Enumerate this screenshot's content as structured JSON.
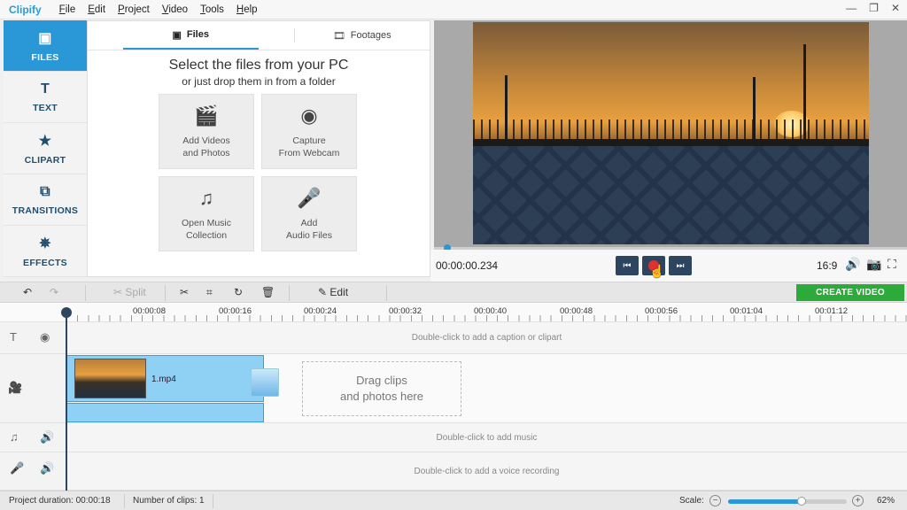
{
  "app": {
    "logo": "Clipify",
    "menu": [
      {
        "key": "F",
        "rest": "ile"
      },
      {
        "key": "E",
        "rest": "dit"
      },
      {
        "key": "P",
        "rest": "roject"
      },
      {
        "key": "V",
        "rest": "ideo"
      },
      {
        "key": "T",
        "rest": "ools"
      },
      {
        "key": "H",
        "rest": "elp"
      }
    ]
  },
  "sidebar": {
    "items": [
      {
        "label": "FILES",
        "icon": "image-icon",
        "active": true
      },
      {
        "label": "TEXT",
        "icon": "text-icon"
      },
      {
        "label": "CLIPART",
        "icon": "star-icon"
      },
      {
        "label": "TRANSITIONS",
        "icon": "transitions-icon"
      },
      {
        "label": "EFFECTS",
        "icon": "magic-wand-icon"
      }
    ]
  },
  "files_panel": {
    "tabs": [
      "Files",
      "Footages"
    ],
    "title": "Select the files from your PC",
    "subtitle": "or just drop them in from a folder",
    "tiles": [
      {
        "line1": "Add Videos",
        "line2": "and Photos",
        "icon": "film-reel-icon"
      },
      {
        "line1": "Capture",
        "line2": "From Webcam",
        "icon": "webcam-icon"
      },
      {
        "line1": "Open Music",
        "line2": "Collection",
        "icon": "music-notes-icon"
      },
      {
        "line1": "Add",
        "line2": "Audio Files",
        "icon": "microphone-icon"
      }
    ]
  },
  "player": {
    "timecode": "00:00:00.234",
    "aspect_ratio": "16:9",
    "progress": 0.02
  },
  "toolbar": {
    "split_label": "Split",
    "edit_label": "Edit",
    "create_label": "CREATE VIDEO"
  },
  "ruler": {
    "labels": [
      "00:00:08",
      "00:00:16",
      "00:00:24",
      "00:00:32",
      "00:00:40",
      "00:00:48",
      "00:00:56",
      "00:01:04",
      "00:01:12"
    ]
  },
  "timeline": {
    "caption_hint": "Double-click to add a caption or clipart",
    "clip_name": "1.mp4",
    "drop_line1": "Drag clips",
    "drop_line2": "and photos here",
    "music_hint": "Double-click to add music",
    "voice_hint": "Double-click to add a voice recording"
  },
  "status": {
    "duration_label": "Project duration:",
    "duration_value": "00:00:18",
    "clips_label": "Number of clips:",
    "clips_value": "1",
    "scale_label": "Scale:",
    "zoom_percent": "62%",
    "zoom_fraction": 0.62
  },
  "colors": {
    "accent": "#2a97d6",
    "create_button": "#2cab3a",
    "play_button": "#e03030"
  }
}
